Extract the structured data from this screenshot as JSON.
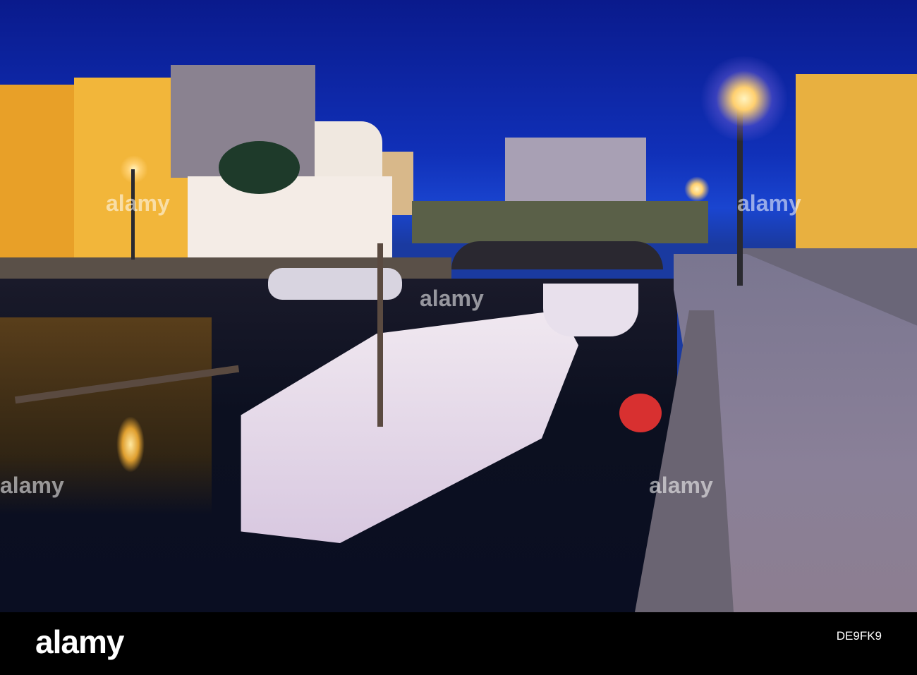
{
  "logo": {
    "text": "alamy"
  },
  "image_id": "DE9FK9",
  "watermark": "alamy",
  "colors": {
    "sky": "#0a1a8c",
    "building_yellow": "#f0b030",
    "lamp": "#ffd070",
    "water": "#0c1020"
  }
}
